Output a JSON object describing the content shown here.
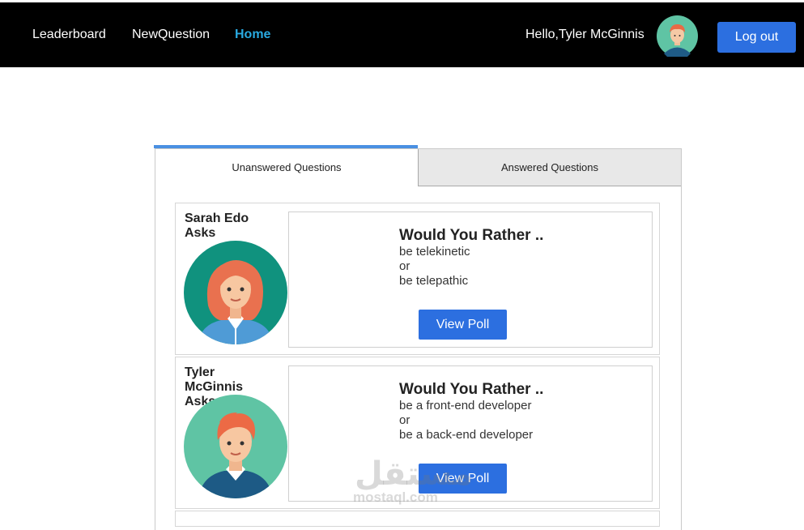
{
  "nav": {
    "links": [
      "Leaderboard",
      "NewQuestion",
      "Home"
    ],
    "active": "Home",
    "greeting": "Hello,Tyler McGinnis",
    "logout_label": "Log out"
  },
  "tabs": {
    "unanswered": "Unanswered Questions",
    "answered": "Answered Questions",
    "active": "Unanswered Questions"
  },
  "questions": [
    {
      "asker": "Sarah Edo",
      "asks_suffix": "Asks",
      "avatar": "woman-avatar-icon",
      "title": "Would You Rather ..",
      "option_one": "be telekinetic",
      "or_text": "or",
      "option_two": "be telepathic",
      "button_label": "View Poll"
    },
    {
      "asker": "Tyler McGinnis",
      "asks_suffix": "Asks",
      "avatar": "man-avatar-icon",
      "title": "Would You Rather ..",
      "option_one": "be a front-end developer",
      "or_text": "or",
      "option_two": "be a back-end developer",
      "button_label": "View Poll"
    }
  ],
  "watermark": {
    "arabic": "مستقل",
    "latin": "mostaql.com"
  },
  "colors": {
    "navbar": "#000000",
    "active_link": "#29a9e0",
    "button": "#2c6fe0",
    "tab_indicator": "#4a90e2"
  }
}
